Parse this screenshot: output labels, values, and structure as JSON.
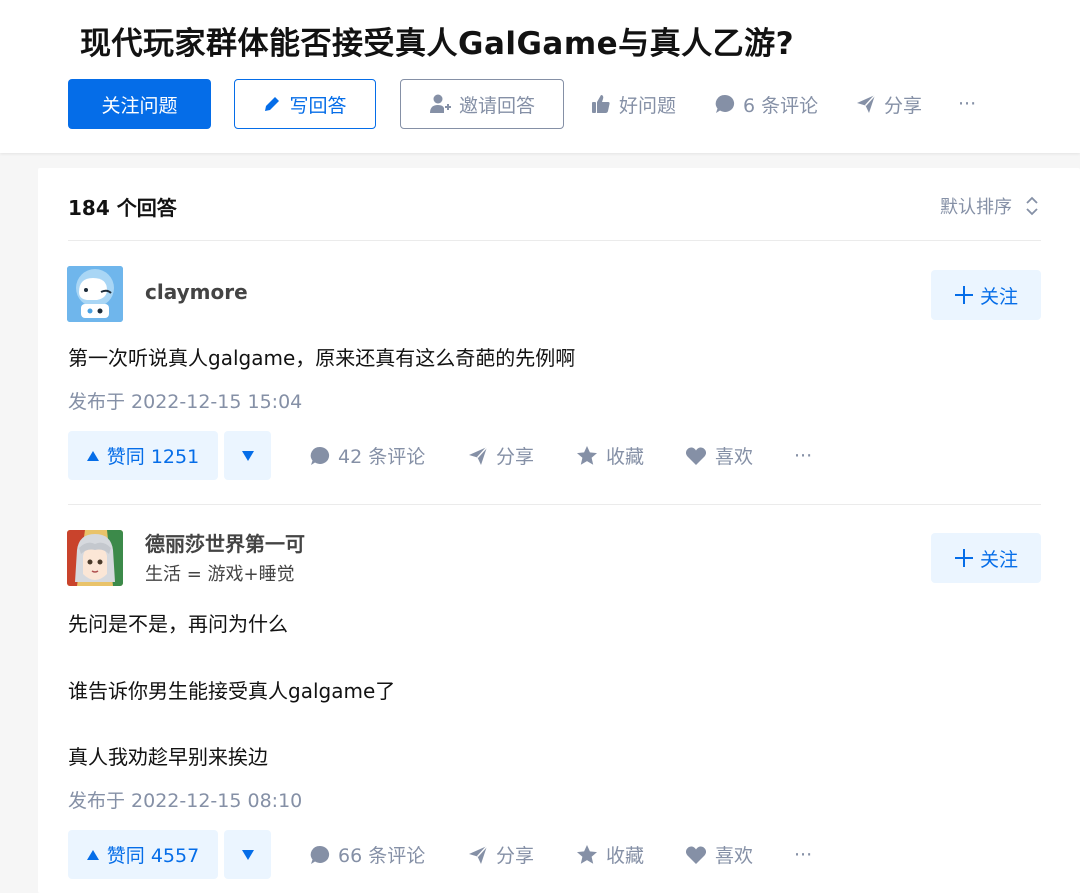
{
  "question": {
    "title": "现代玩家群体能否接受真人GalGame与真人乙游?",
    "follow_label": "关注问题",
    "write_label": "写回答",
    "invite_label": "邀请回答",
    "good_label": "好问题",
    "comments_label": "6 条评论",
    "share_label": "分享",
    "more_label": "···"
  },
  "answers_header": {
    "count_label": "184 个回答",
    "sort_label": "默认排序"
  },
  "answers": [
    {
      "author": "claymore",
      "headline": "",
      "follow_label": "关注",
      "lines": [
        "第一次听说真人galgame，原来还真有这么奇葩的先例啊"
      ],
      "time": "发布于 2022-12-15 15:04",
      "upvote_label": "赞同 1251",
      "comments_label": "42 条评论",
      "share_label": "分享",
      "collect_label": "收藏",
      "like_label": "喜欢",
      "more_label": "···"
    },
    {
      "author": "德丽莎世界第一可",
      "headline": "生活 = 游戏+睡觉",
      "follow_label": "关注",
      "lines": [
        "先问是不是，再问为什么",
        "谁告诉你男生能接受真人galgame了",
        "真人我劝趁早别来挨边"
      ],
      "time": "发布于 2022-12-15 08:10",
      "upvote_label": "赞同 4557",
      "comments_label": "66 条评论",
      "share_label": "分享",
      "collect_label": "收藏",
      "like_label": "喜欢",
      "more_label": "···"
    }
  ],
  "colors": {
    "primary": "#056de8",
    "primary_light": "#ebf5ff",
    "meta_gray": "#8590a6"
  }
}
